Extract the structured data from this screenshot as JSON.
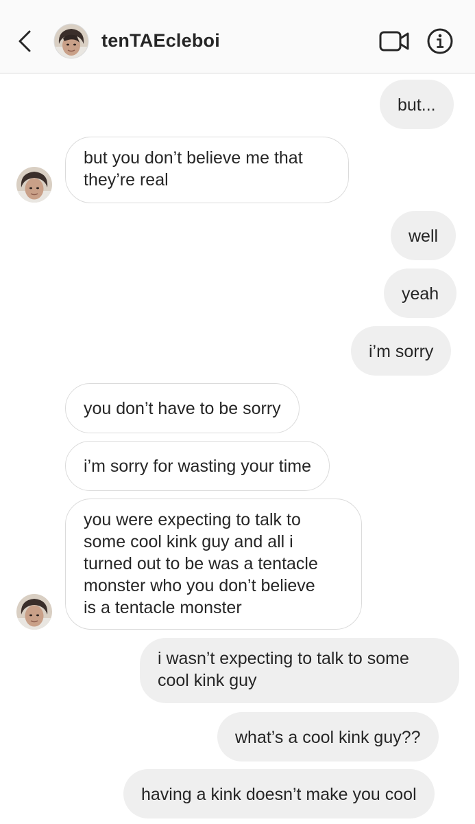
{
  "header": {
    "username": "tenTAEcleboi",
    "back_icon": "chevron-left-icon",
    "video_icon": "video-camera-icon",
    "info_icon": "info-icon"
  },
  "messages": [
    {
      "direction": "out",
      "text": "but..."
    },
    {
      "direction": "in",
      "text": "but you don’t believe me that\nthey’re real"
    },
    {
      "direction": "out",
      "text": "well"
    },
    {
      "direction": "out",
      "text": "yeah"
    },
    {
      "direction": "out",
      "text": "i’m sorry"
    },
    {
      "direction": "in",
      "text": "you don’t have to be sorry"
    },
    {
      "direction": "in",
      "text": "i’m sorry for wasting your time"
    },
    {
      "direction": "in",
      "text": "you were expecting to talk to\nsome cool kink guy and all i\nturned out to be was a tentacle\nmonster who you don’t believe\nis a tentacle monster"
    },
    {
      "direction": "out",
      "text": "i wasn’t expecting to talk to some\ncool kink guy"
    },
    {
      "direction": "out",
      "text": "what’s a cool kink guy??"
    },
    {
      "direction": "out",
      "text": "having a kink doesn’t make you cool"
    }
  ],
  "colors": {
    "outgoing_bubble": "#efefef",
    "incoming_border": "#dbdbdb",
    "text": "#262626",
    "header_bg": "#fafafa"
  }
}
